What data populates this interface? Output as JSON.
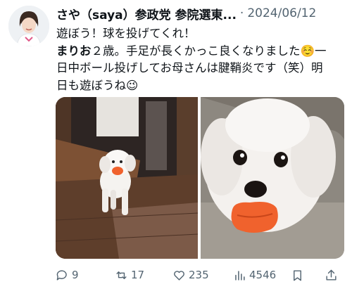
{
  "post": {
    "author_name": "さや（saya）参政党 参院選東...",
    "separator": "·",
    "date": "2024/06/12",
    "lines": [
      [
        {
          "t": "遊ぼう！球を投げてくれ！",
          "b": false
        }
      ],
      [
        {
          "t": "まりお",
          "b": true
        },
        {
          "t": "２歳。手足が長くかっこ良くなりました☺️一",
          "b": false
        }
      ],
      [
        {
          "t": "日中ボール投げしてお母さんは腱鞘炎です（笑）明",
          "b": false
        }
      ],
      [
        {
          "t": "日も遊ぼうね😉",
          "b": false
        }
      ]
    ]
  },
  "actions": {
    "reply_count": "9",
    "repost_count": "17",
    "like_count": "235",
    "view_count": "4546"
  },
  "colors": {
    "text": "#0f1419",
    "muted": "#536471",
    "ball": "#f0622d"
  }
}
